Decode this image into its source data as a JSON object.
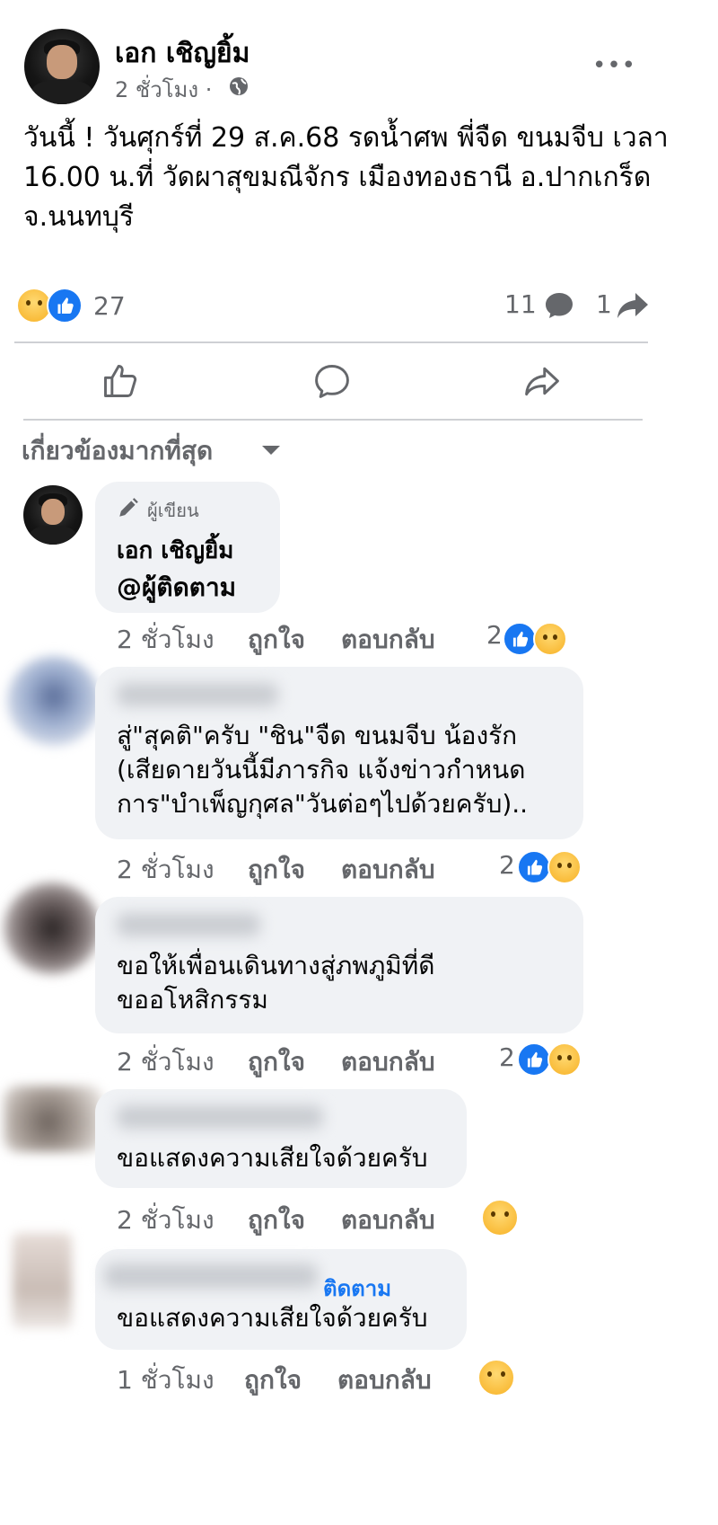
{
  "post": {
    "author": "เอก เชิญยิ้ม",
    "time": "2 ชั่วโมง ·",
    "more": "•••",
    "text_lines": [
      "วันนี้ ! วันศุกร์ที่ 29 ส.ค.68 รดน้ำศพ พี่จืด ขนมจีบ เวลา",
      "16.00 น.ที่ วัดผาสุขมณีจักร เมืองทองธานี อ.ปากเกร็ด",
      "จ.นนทบุรี"
    ],
    "reaction_count": "27",
    "comment_count": "11",
    "share_count": "1"
  },
  "sort_label": "เกี่ยวข้องมากที่สุด",
  "comments": [
    {
      "badge": "ผู้เขียน",
      "name": "เอก เชิญยิ้ม",
      "text_lines": [
        "@ผู้ติดตาม"
      ],
      "time": "2 ชั่วโมง",
      "like": "ถูกใจ",
      "reply": "ตอบกลับ",
      "reaction_count": "2"
    },
    {
      "text_lines": [
        "สู่\"สุคติ\"ครับ \"ชิน\"จืด ขนมจีบ น้องรัก",
        "(เสียดายวันนี้มีภารกิจ แจ้งข่าวกำหนด",
        "การ\"บำเพ็ญกุศล\"วันต่อๆไปด้วยครับ).."
      ],
      "time": "2 ชั่วโมง",
      "like": "ถูกใจ",
      "reply": "ตอบกลับ",
      "reaction_count": "2"
    },
    {
      "text_lines": [
        "ขอให้เพื่อนเดินทางสู่ภพภูมิที่ดี",
        "ขออโหสิกรรม"
      ],
      "time": "2 ชั่วโมง",
      "like": "ถูกใจ",
      "reply": "ตอบกลับ",
      "reaction_count": "2"
    },
    {
      "text_lines": [
        "ขอแสดงความเสียใจด้วยครับ"
      ],
      "time": "2 ชั่วโมง",
      "like": "ถูกใจ",
      "reply": "ตอบกลับ"
    },
    {
      "follow": "ติดตาม",
      "text_lines": [
        "ขอแสดงความเสียใจด้วยครับ"
      ],
      "time": "1 ชั่วโมง",
      "like": "ถูกใจ",
      "reply": "ตอบกลับ"
    }
  ],
  "colors": {
    "like_blue": "#1877f2",
    "text": "#050505",
    "meta_gray": "#65676b",
    "bubble": "#f0f2f5"
  },
  "icons": [
    "globe-icon",
    "like-reaction-icon",
    "sad-reaction-icon",
    "comment-icon",
    "share-icon",
    "like-outline-icon",
    "comment-outline-icon",
    "share-outline-icon",
    "caret-down-icon",
    "pen-icon"
  ]
}
